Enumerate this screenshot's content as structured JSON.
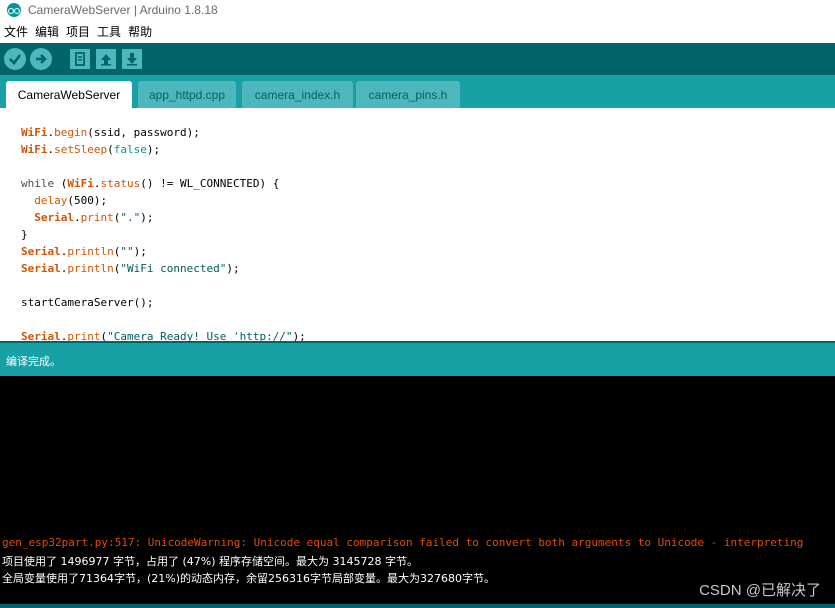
{
  "window": {
    "title": "CameraWebServer | Arduino 1.8.18"
  },
  "menu": [
    "文件",
    "编辑",
    "项目",
    "工具",
    "帮助"
  ],
  "toolbar": {
    "buttons": [
      "verify-icon",
      "upload-icon",
      "new-icon",
      "open-icon",
      "save-icon"
    ]
  },
  "tabs": [
    "CameraWebServer",
    "app_httpd.cpp",
    "camera_index.h",
    "camera_pins.h"
  ],
  "code": [
    "WiFi.begin(ssid, password);",
    "WiFi.setSleep(false);",
    "",
    "while (WiFi.status() != WL_CONNECTED) {",
    "  delay(500);",
    "  Serial.print(\".\");",
    "}",
    "Serial.println(\"\");",
    "Serial.println(\"WiFi connected\");",
    "",
    "startCameraServer();",
    "",
    "Serial.print(\"Camera Ready! Use 'http://\");"
  ],
  "status": {
    "message": "编译完成。"
  },
  "console": {
    "lines": [
      "gen_esp32part.py:517: UnicodeWarning: Unicode equal comparison failed to convert both arguments to Unicode - interpreting",
      "项目使用了 1496977 字节，占用了 (47%) 程序存储空间。最大为 3145728 字节。",
      "全局变量使用了71364字节，(21%)的动态内存，余留256316字节局部变量。最大为327680字节。"
    ]
  },
  "watermark": "CSDN @已解决了",
  "colors": {
    "toolbar": "#006468",
    "tabbar": "#17a1a5",
    "tab_inactive": "#4db7bb",
    "button": "#4db7bb",
    "console_bg": "#000000",
    "warning_text": "#e34c00"
  }
}
